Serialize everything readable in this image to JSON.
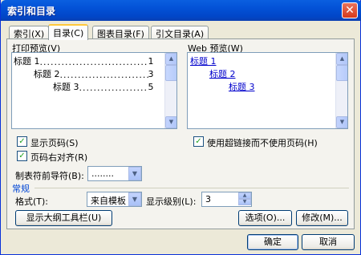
{
  "window": {
    "title": "索引和目录"
  },
  "tabs": [
    {
      "label": "索引(X)"
    },
    {
      "label": "目录(C)"
    },
    {
      "label": "图表目录(F)"
    },
    {
      "label": "引文目录(A)"
    }
  ],
  "print_preview": {
    "label": "打印预览(V)",
    "lines": [
      {
        "text": "标题 1",
        "page": "1"
      },
      {
        "text": "标题 2",
        "page": "3"
      },
      {
        "text": "标题 3",
        "page": "5"
      }
    ]
  },
  "web_preview": {
    "label": "Web 预览(W)",
    "lines": [
      "标题 1",
      "标题 2",
      "标题 3"
    ]
  },
  "options": {
    "show_page_numbers": "显示页码(S)",
    "right_align": "页码右对齐(R)",
    "tab_leader_label": "制表符前导符(B):",
    "tab_leader_value": "........",
    "hyperlinks": "使用超链接而不使用页码(H)"
  },
  "general": {
    "heading": "常规",
    "format_label": "格式(T):",
    "format_value": "来自模板",
    "levels_label": "显示级别(L):",
    "levels_value": "3"
  },
  "buttons": {
    "outline": "显示大纲工具栏(U)",
    "options": "选项(O)...",
    "modify": "修改(M)...",
    "ok": "确定",
    "cancel": "取消"
  }
}
